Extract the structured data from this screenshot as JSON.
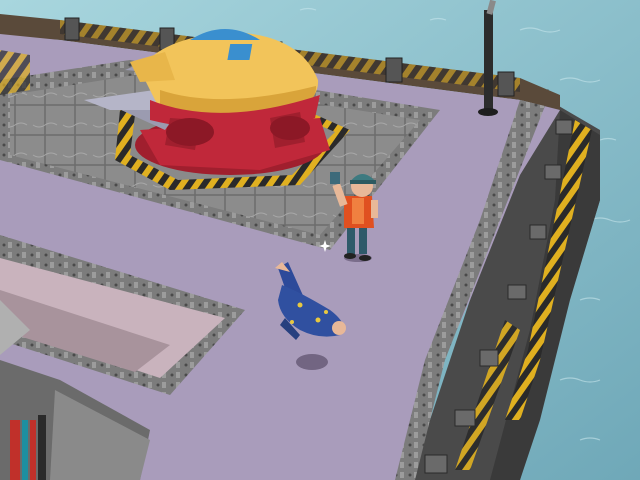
{
  "scene": {
    "description_free": true,
    "colors": {
      "sea": "#8ec3cf",
      "sea_dark": "#5e9bab",
      "deck": "#a79ab8",
      "deck_shadow": "#8e82a0",
      "hull": "#5a5a5a",
      "hull_dark": "#3b3b3b",
      "metal_plate": "#8f8f8f",
      "metal_dark": "#6b6b6b",
      "hazard_yellow": "#e0b020",
      "hazard_black": "#2a2a2a",
      "ship_yellow": "#f2c45a",
      "ship_red": "#c0283a",
      "ship_blue": "#3a8fcf",
      "character_vest": "#e05020",
      "character_helmet": "#3d7a80",
      "character_pants": "#2f5a6a",
      "wizard_robe": "#3050a0",
      "wizard_star": "#e8c840"
    },
    "sprites": {
      "ufo": "spaceship-icon",
      "player": "engineer-character",
      "npc": "fallen-wizard-character",
      "cursor": "sparkle-icon",
      "mast": "antenna-pole"
    }
  }
}
